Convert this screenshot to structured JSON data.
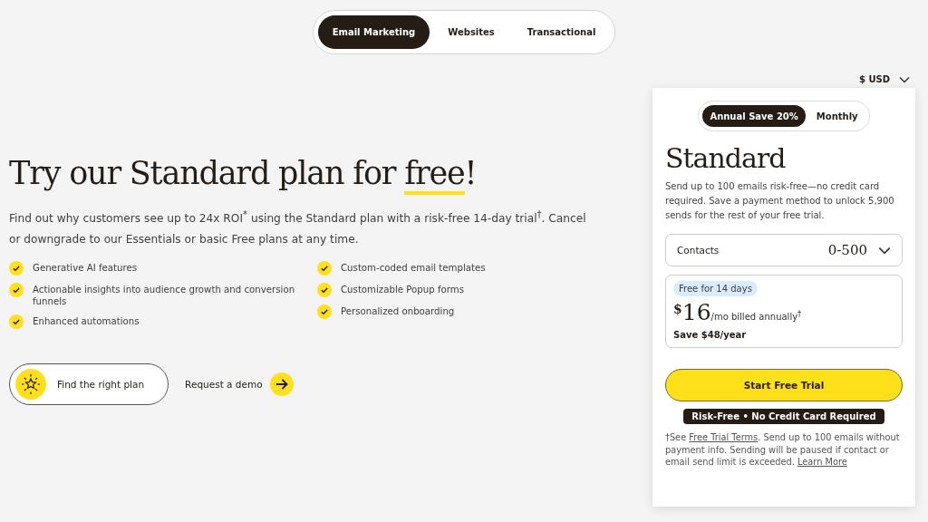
{
  "product_tabs": [
    {
      "label": "Email Marketing",
      "selected": true
    },
    {
      "label": "Websites",
      "selected": false
    },
    {
      "label": "Transactional",
      "selected": false
    }
  ],
  "currency": {
    "label": "$ USD"
  },
  "hero": {
    "heading": [
      {
        "text": "Try our Standard plan for ",
        "highlight": false
      },
      {
        "text": "free",
        "highlight": true
      },
      {
        "text": "!",
        "highlight": false
      }
    ],
    "description": "Find out why customers see up to 24x ROI$^{*}$ using the Standard plan with a risk-free 14-day trial$^{†}$. Cancel or downgrade to our Essentials or basic Free plans at any time.",
    "features": [
      {
        "label": "Generative AI features"
      },
      {
        "label": "Actionable insights into audience growth and conversion funnels"
      },
      {
        "label": "Enhanced automations"
      },
      {
        "label": "Custom-coded email templates"
      },
      {
        "label": "Customizable Popup forms"
      },
      {
        "label": "Personalized onboarding"
      }
    ],
    "primary_button": "Find the right plan",
    "demo_link": "Request a demo"
  },
  "plan_card": {
    "billing_tabs": [
      {
        "label": "Annual Save 20%",
        "selected": true
      },
      {
        "label": "Monthly",
        "selected": false
      }
    ],
    "title": "Standard",
    "description": "Send up to 100 emails risk-free—no credit card required. Save a payment method to unlock 5,900 sends for the rest of your free trial.",
    "contacts": {
      "label": "Contacts",
      "value": "0-500"
    },
    "badge": "Free for 14 days",
    "currency_symbol": "$",
    "price": "16",
    "period": "/mo billed annually$^{†}$",
    "savings": "Save $48/year",
    "cta": "Start Free Trial",
    "note_badge": "Risk-Free • No Credit Card Required",
    "footnote": [
      {
        "kind": "text",
        "text": "†See "
      },
      {
        "kind": "link",
        "text": "Free Trial Terms"
      },
      {
        "kind": "text",
        "text": ". Send up to 100 emails without payment info. Sending will be paused if contact or email send limit is exceeded. "
      },
      {
        "kind": "link",
        "text": "Learn More"
      }
    ]
  }
}
